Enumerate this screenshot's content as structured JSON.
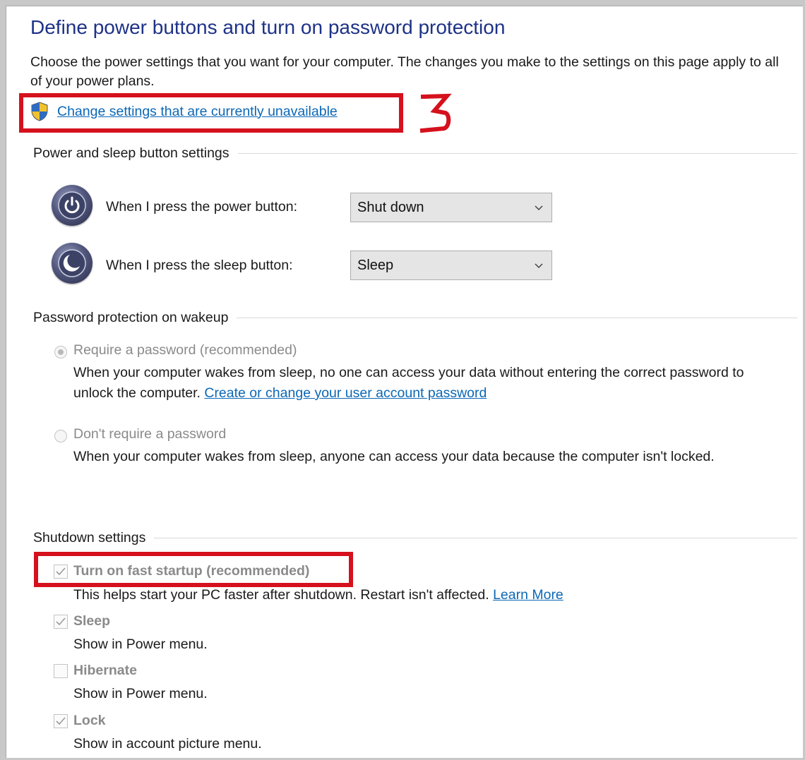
{
  "header": {
    "title": "Define power buttons and turn on password protection",
    "intro": "Choose the power settings that you want for your computer. The changes you make to the settings on this page apply to all of your power plans.",
    "change_link": "Change settings that are currently unavailable",
    "annotation_number": "3"
  },
  "power_sleep": {
    "heading": "Power and sleep button settings",
    "power_button": {
      "label": "When I press the power button:",
      "value": "Shut down",
      "icon": "power-icon"
    },
    "sleep_button": {
      "label": "When I press the sleep button:",
      "value": "Sleep",
      "icon": "sleep-moon-icon"
    }
  },
  "password": {
    "heading": "Password protection on wakeup",
    "require": {
      "label": "Require a password (recommended)",
      "selected": true,
      "desc": "When your computer wakes from sleep, no one can access your data without entering the correct password to unlock the computer.",
      "link": "Create or change your user account password"
    },
    "dont_require": {
      "label": "Don't require a password",
      "selected": false,
      "desc": "When your computer wakes from sleep, anyone can access your data because the computer isn't locked."
    }
  },
  "shutdown": {
    "heading": "Shutdown settings",
    "fast_startup": {
      "label": "Turn on fast startup (recommended)",
      "checked": true,
      "desc": "This helps start your PC faster after shutdown. Restart isn't affected.",
      "link": "Learn More"
    },
    "sleep": {
      "label": "Sleep",
      "checked": true,
      "desc": "Show in Power menu."
    },
    "hibernate": {
      "label": "Hibernate",
      "checked": false,
      "desc": "Show in Power menu."
    },
    "lock": {
      "label": "Lock",
      "checked": true,
      "desc": "Show in account picture menu."
    }
  },
  "colors": {
    "title": "#1e3287",
    "link": "#0b67b5",
    "annotation_red": "#d5111d",
    "disabled_text": "#8a8a8a"
  }
}
